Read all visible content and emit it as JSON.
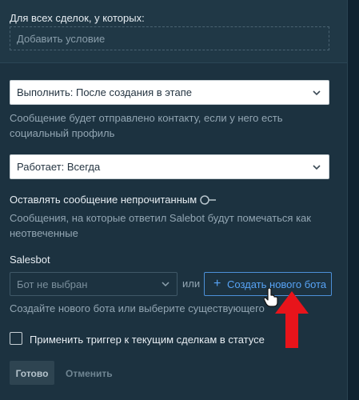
{
  "conditions": {
    "title": "Для всех сделок, у которых:",
    "add_placeholder": "Добавить условие"
  },
  "execute": {
    "value": "Выполнить: После создания в этапе",
    "hint_line1": "Сообщение будет отправлено контакту, если у него есть",
    "hint_line2": "социальный профиль"
  },
  "works": {
    "value": "Работает: Всегда"
  },
  "unread": {
    "label": "Оставлять сообщение непрочитанным",
    "enabled": false,
    "hint_line1": "Сообщения, на которые ответил Salebot будут помечаться как",
    "hint_line2": "неотвеченные"
  },
  "salesbot": {
    "label": "Salesbot",
    "select_value": "Бот не выбран",
    "or": "или",
    "create_button": "Создать нового бота",
    "create_plus": "+",
    "hint": "Создайте нового бота или выберите существующего"
  },
  "apply": {
    "label": "Применить триггер к текущим сделкам в статусе",
    "checked": false
  },
  "footer": {
    "done": "Готово",
    "cancel": "Отменить"
  },
  "colors": {
    "background": "#1c3240",
    "accent": "#57a3f5",
    "annotation_arrow": "#e8141b"
  },
  "icons": {
    "select_arrow": "chevron-down-icon",
    "cursor": "hand-pointer-icon",
    "annotation": "red-arrow-icon"
  }
}
